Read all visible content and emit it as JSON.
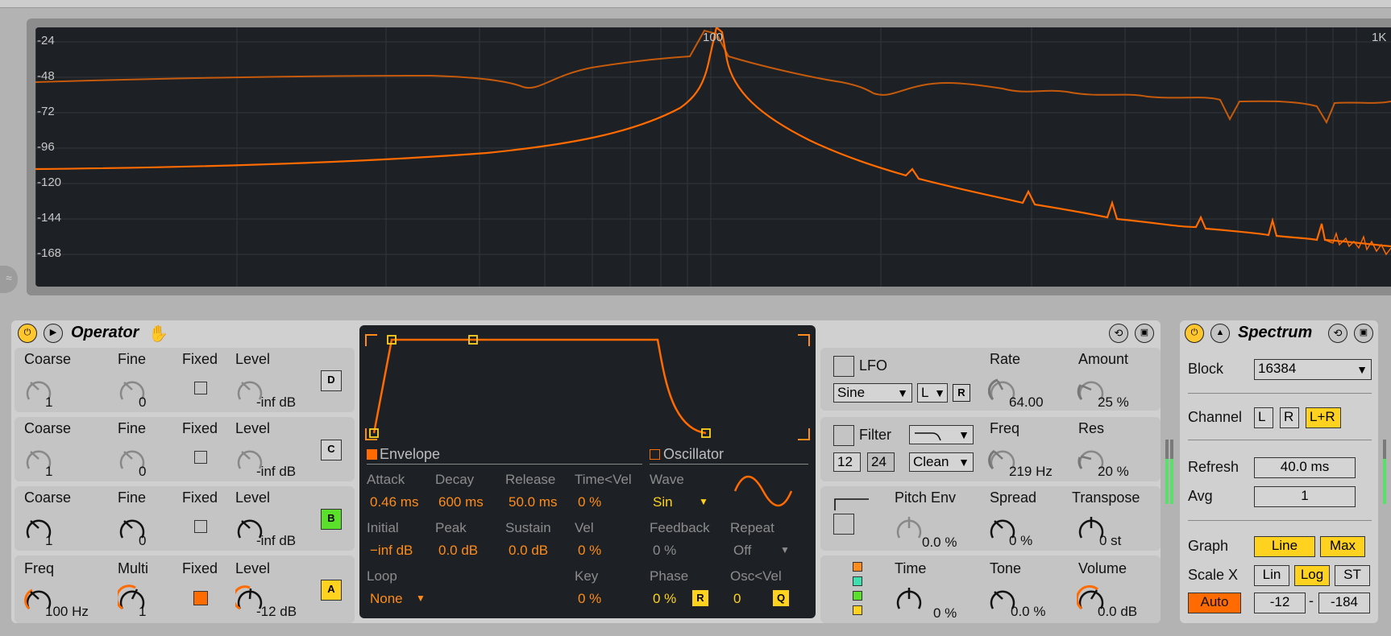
{
  "spectrum_view": {
    "y_labels": [
      "-24",
      "-48",
      "-72",
      "-96",
      "-120",
      "-144",
      "-168"
    ],
    "x_labels": [
      "100",
      "1K"
    ]
  },
  "operator": {
    "title": "Operator",
    "ops": [
      {
        "letter": "D",
        "coarse_label": "Coarse",
        "fine_label": "Fine",
        "fixed_label": "Fixed",
        "level_label": "Level",
        "coarse": "1",
        "fine": "0",
        "level": "-inf dB"
      },
      {
        "letter": "C",
        "coarse_label": "Coarse",
        "fine_label": "Fine",
        "fixed_label": "Fixed",
        "level_label": "Level",
        "coarse": "1",
        "fine": "0",
        "level": "-inf dB"
      },
      {
        "letter": "B",
        "coarse_label": "Coarse",
        "fine_label": "Fine",
        "fixed_label": "Fixed",
        "level_label": "Level",
        "coarse": "1",
        "fine": "0",
        "level": "-inf dB"
      },
      {
        "letter": "A",
        "coarse_label": "Freq",
        "fine_label": "Multi",
        "fixed_label": "Fixed",
        "level_label": "Level",
        "coarse": "100 Hz",
        "fine": "1",
        "level": "-12 dB"
      }
    ],
    "envelope": {
      "header": "Envelope",
      "attack_label": "Attack",
      "attack": "0.46 ms",
      "decay_label": "Decay",
      "decay": "600 ms",
      "release_label": "Release",
      "release": "50.0 ms",
      "timevel_label": "Time<Vel",
      "timevel": "0 %",
      "initial_label": "Initial",
      "initial": "−inf dB",
      "peak_label": "Peak",
      "peak": "0.0 dB",
      "sustain_label": "Sustain",
      "sustain": "0.0 dB",
      "vel_label": "Vel",
      "vel": "0 %",
      "loop_label": "Loop",
      "loop": "None",
      "key_label": "Key",
      "key": "0 %"
    },
    "oscillator": {
      "header": "Oscillator",
      "wave_label": "Wave",
      "wave": "Sin",
      "feedback_label": "Feedback",
      "feedback": "0 %",
      "repeat_label": "Repeat",
      "repeat": "Off",
      "phase_label": "Phase",
      "phase": "0 %",
      "r_btn": "R",
      "oscvel_label": "Osc<Vel",
      "oscvel": "0",
      "q_btn": "Q"
    },
    "lfo": {
      "label": "LFO",
      "wave": "Sine",
      "dest": "L",
      "r_btn": "R",
      "rate_label": "Rate",
      "rate": "64.00",
      "amount_label": "Amount",
      "amount": "25 %"
    },
    "filter": {
      "label": "Filter",
      "btn12": "12",
      "btn24": "24",
      "mode": "Clean",
      "freq_label": "Freq",
      "freq": "219 Hz",
      "res_label": "Res",
      "res": "20 %"
    },
    "pitch": {
      "pitch_env_label": "Pitch Env",
      "pitch_env": "0.0 %",
      "spread_label": "Spread",
      "spread": "0 %",
      "transpose_label": "Transpose",
      "transpose": "0 st"
    },
    "global": {
      "time_label": "Time",
      "time": "0 %",
      "tone_label": "Tone",
      "tone": "0.0 %",
      "volume_label": "Volume",
      "volume": "0.0 dB"
    }
  },
  "spectrum": {
    "title": "Spectrum",
    "block_label": "Block",
    "block": "16384",
    "channel_label": "Channel",
    "ch_l": "L",
    "ch_r": "R",
    "ch_lr": "L+R",
    "refresh_label": "Refresh",
    "refresh": "40.0 ms",
    "avg_label": "Avg",
    "avg": "1",
    "graph_label": "Graph",
    "graph_line": "Line",
    "graph_max": "Max",
    "scalex_label": "Scale X",
    "scale_lin": "Lin",
    "scale_log": "Log",
    "scale_st": "ST",
    "auto": "Auto",
    "range_low": "-12",
    "range_dash": "-",
    "range_high": "-184"
  },
  "colors": {
    "accent": "#ff6b00",
    "active_yellow": "#ffd21f",
    "device_bg": "#c4c4c4",
    "display_bg": "#1d2024"
  }
}
